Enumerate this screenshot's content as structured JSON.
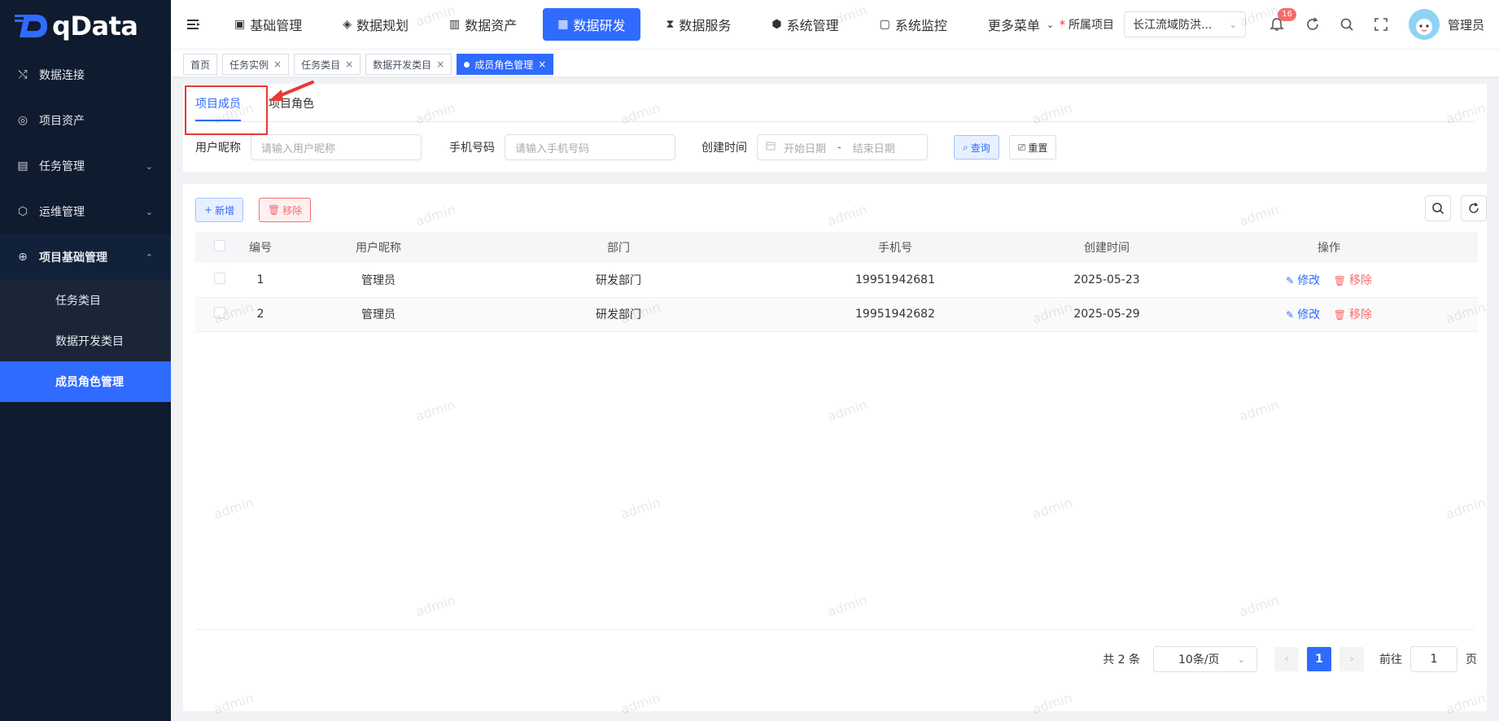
{
  "brand": {
    "name": "qData"
  },
  "sidebar": {
    "items": [
      {
        "label": "数据连接",
        "icon": "shuffle-icon"
      },
      {
        "label": "项目资产",
        "icon": "cog-circle-icon"
      },
      {
        "label": "任务管理",
        "icon": "document-icon",
        "expandable": true
      },
      {
        "label": "运维管理",
        "icon": "cube-icon",
        "expandable": true
      },
      {
        "label": "项目基础管理",
        "icon": "globe-icon",
        "expandable": true,
        "expanded": true
      }
    ],
    "subitems": [
      {
        "label": "任务类目"
      },
      {
        "label": "数据开发类目"
      },
      {
        "label": "成员角色管理",
        "active": true
      }
    ]
  },
  "topnav": {
    "items": [
      {
        "label": "基础管理"
      },
      {
        "label": "数据规划"
      },
      {
        "label": "数据资产"
      },
      {
        "label": "数据研发",
        "active": true
      },
      {
        "label": "数据服务"
      },
      {
        "label": "系统管理"
      },
      {
        "label": "系统监控"
      },
      {
        "label": "更多菜单"
      }
    ],
    "project_label": "所属项目",
    "project_value": "长江流域防洪...",
    "notification_count": "16",
    "username": "管理员"
  },
  "tags": [
    {
      "label": "首页"
    },
    {
      "label": "任务实例"
    },
    {
      "label": "任务类目"
    },
    {
      "label": "数据开发类目"
    },
    {
      "label": "成员角色管理",
      "active": true
    }
  ],
  "search": {
    "tabs": [
      "项目成员",
      "项目角色"
    ],
    "nickname_label": "用户昵称",
    "nickname_placeholder": "请输入用户昵称",
    "phone_label": "手机号码",
    "phone_placeholder": "请输入手机号码",
    "time_label": "创建时间",
    "start_placeholder": "开始日期",
    "range_sep": "-",
    "end_placeholder": "结束日期",
    "query_label": "查询",
    "reset_label": "重置"
  },
  "toolbar": {
    "add_label": "新增",
    "remove_label": "移除"
  },
  "table": {
    "headers": [
      "编号",
      "用户昵称",
      "部门",
      "手机号",
      "创建时间",
      "操作"
    ],
    "rows": [
      {
        "id": "1",
        "nickname": "管理员",
        "dept": "研发部门",
        "phone": "19951942681",
        "created": "2025-05-23",
        "edit": "修改",
        "remove": "移除"
      },
      {
        "id": "2",
        "nickname": "管理员",
        "dept": "研发部门",
        "phone": "19951942682",
        "created": "2025-05-29",
        "edit": "修改",
        "remove": "移除"
      }
    ]
  },
  "pagination": {
    "total_text": "共 2 条",
    "page_size": "10条/页",
    "current_page": "1",
    "goto_label": "前往",
    "goto_value": "1",
    "page_suffix": "页"
  },
  "watermark": "admin",
  "colors": {
    "accent": "#2f6bff",
    "sidebar_bg": "#0f1b2e",
    "danger": "#f56c6c",
    "annotation": "#e53935"
  }
}
